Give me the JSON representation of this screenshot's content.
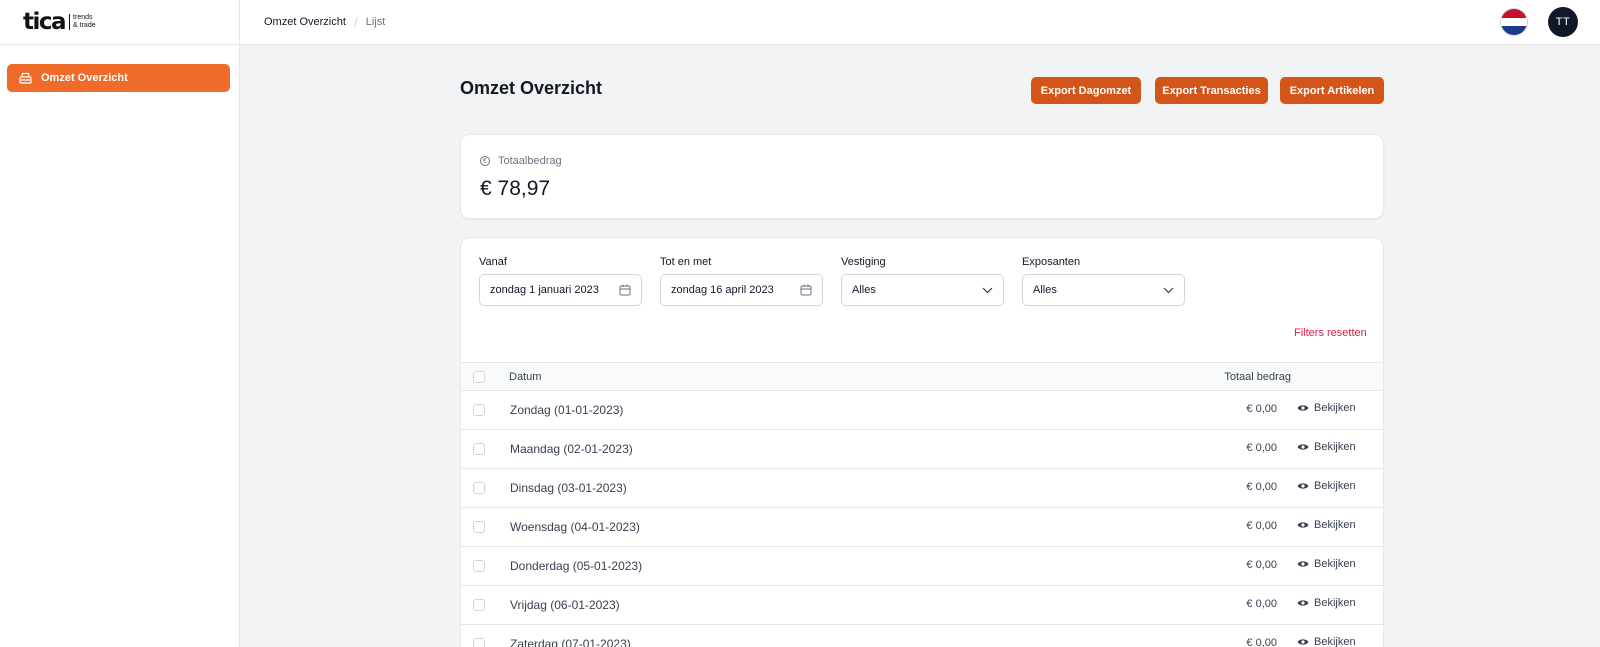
{
  "brand": {
    "name": "tica",
    "tagline_1": "trends",
    "tagline_2": "& trade"
  },
  "sidebar": {
    "items": [
      {
        "label": "Omzet Overzicht",
        "active": true
      }
    ]
  },
  "breadcrumb": {
    "items": [
      "Omzet Overzicht",
      "Lijst"
    ]
  },
  "user": {
    "initials": "TT",
    "language_flag": "netherlands-flag-icon"
  },
  "page": {
    "title": "Omzet Overzicht"
  },
  "actions": {
    "export_dagomzet": "Export Dagomzet",
    "export_transacties": "Export Transacties",
    "export_artikelen": "Export Artikelen"
  },
  "summary": {
    "label": "Totaalbedrag",
    "value": "€ 78,97"
  },
  "filters": {
    "vanaf": {
      "label": "Vanaf",
      "value": "zondag 1 januari 2023"
    },
    "tot": {
      "label": "Tot en met",
      "value": "zondag 16 april 2023"
    },
    "vestiging": {
      "label": "Vestiging",
      "value": "Alles"
    },
    "exposanten": {
      "label": "Exposanten",
      "value": "Alles"
    },
    "reset_label": "Filters resetten"
  },
  "table": {
    "columns": {
      "datum": "Datum",
      "totaal": "Totaal bedrag"
    },
    "view_label": "Bekijken",
    "rows": [
      {
        "date": "Zondag (01-01-2023)",
        "amount": "€ 0,00"
      },
      {
        "date": "Maandag (02-01-2023)",
        "amount": "€ 0,00"
      },
      {
        "date": "Dinsdag (03-01-2023)",
        "amount": "€ 0,00"
      },
      {
        "date": "Woensdag (04-01-2023)",
        "amount": "€ 0,00"
      },
      {
        "date": "Donderdag (05-01-2023)",
        "amount": "€ 0,00"
      },
      {
        "date": "Vrijdag (06-01-2023)",
        "amount": "€ 0,00"
      },
      {
        "date": "Zaterdag (07-01-2023)",
        "amount": "€ 0,00"
      }
    ]
  },
  "colors": {
    "accent": "#ef6b2a",
    "button": "#d4551a",
    "reset": "#e11d48"
  }
}
